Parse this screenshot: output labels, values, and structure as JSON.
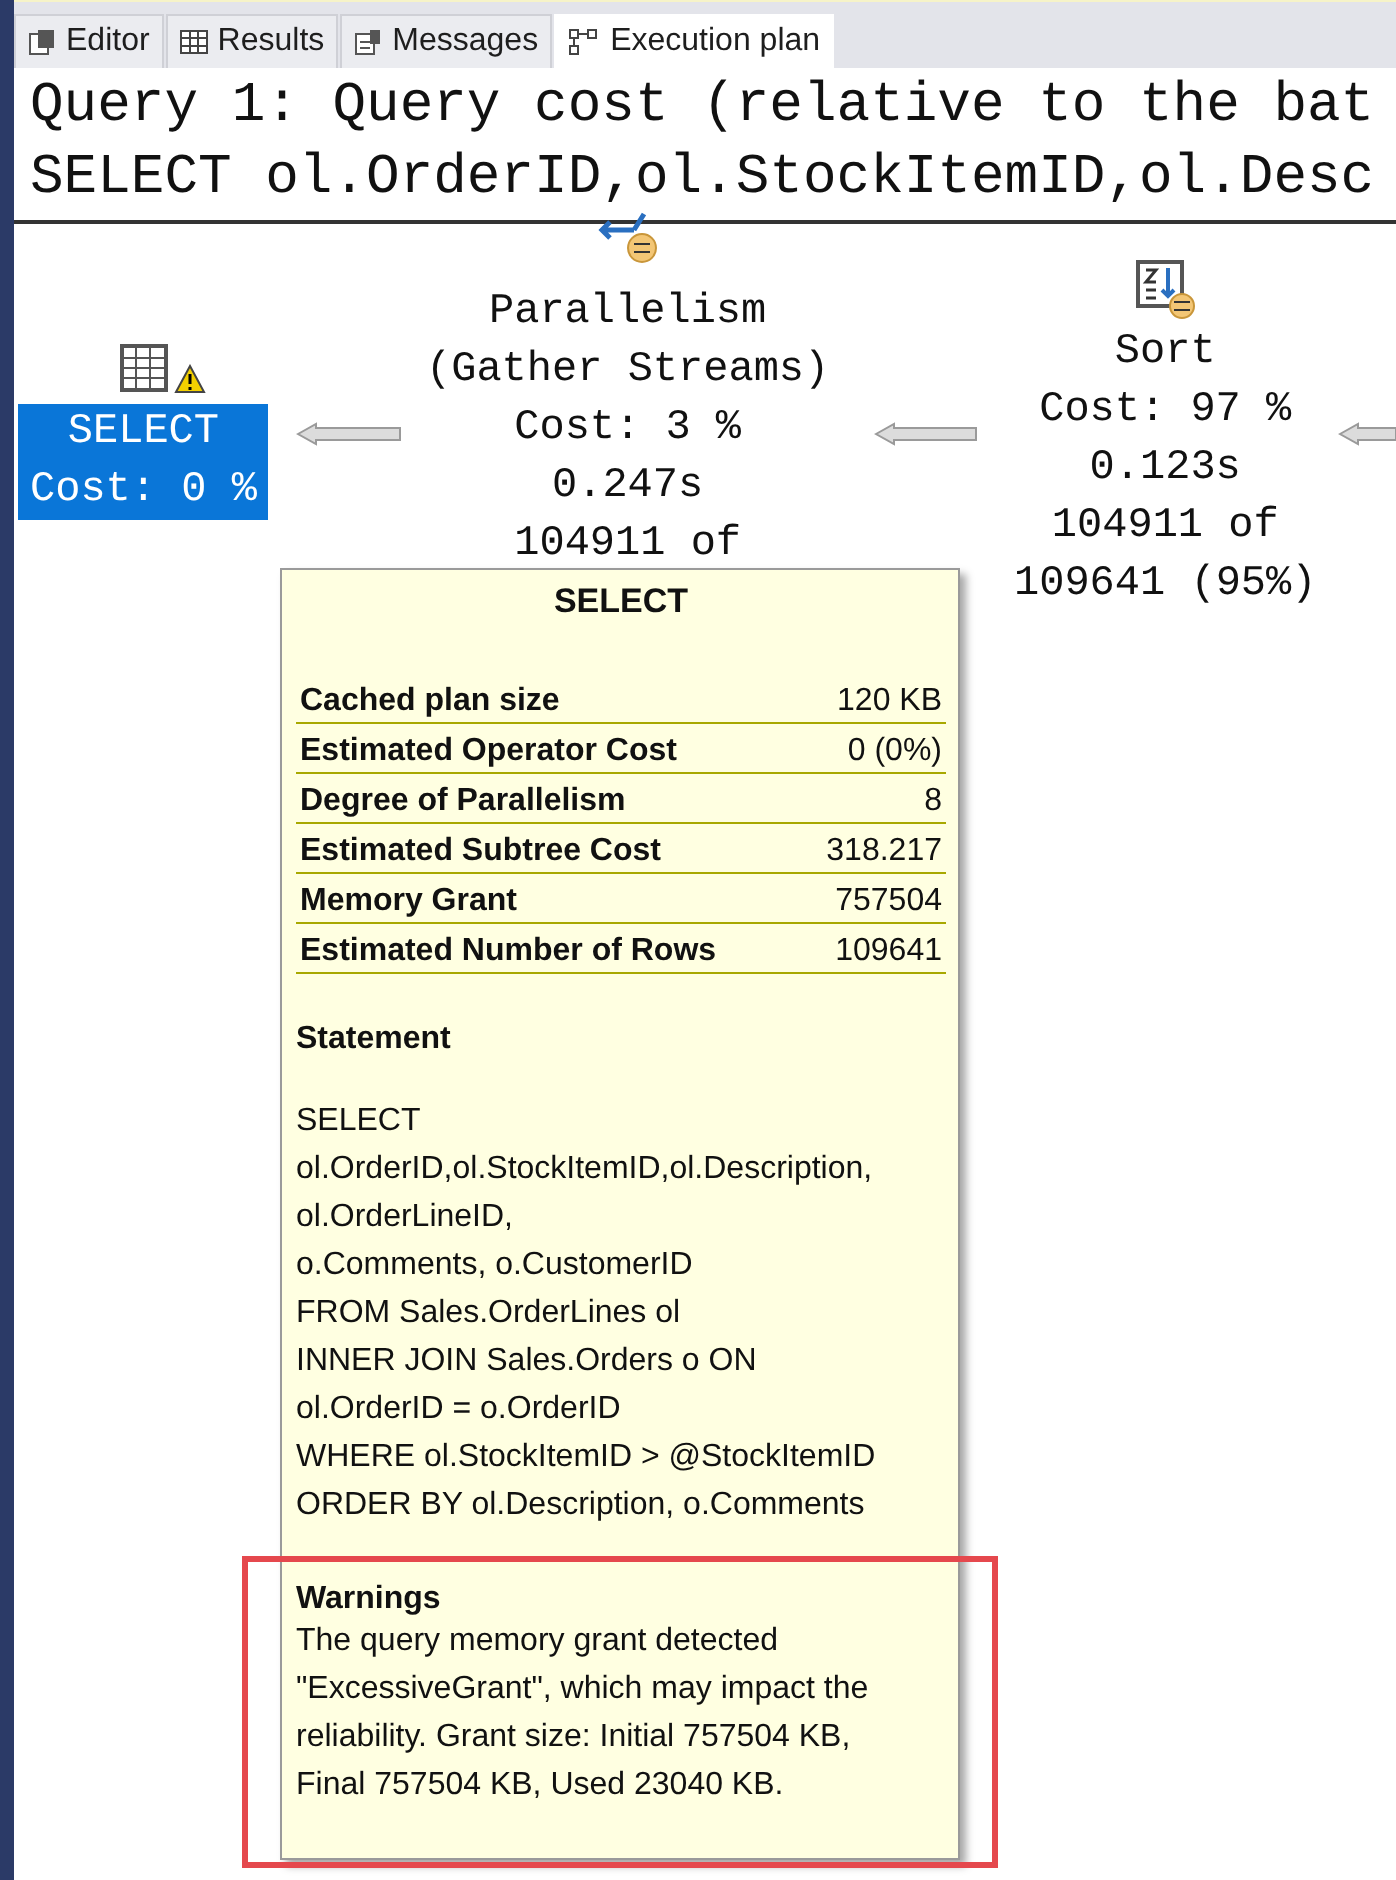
{
  "tabs": [
    {
      "label": "Editor",
      "kind": "editor",
      "selected": false
    },
    {
      "label": "Results",
      "kind": "grid",
      "selected": false
    },
    {
      "label": "Messages",
      "kind": "messages",
      "selected": false
    },
    {
      "label": "Execution plan",
      "kind": "plan",
      "selected": true
    }
  ],
  "query_header": [
    "Query 1: Query cost (relative to the bat",
    "SELECT ol.OrderID,ol.StockItemID,ol.Desc"
  ],
  "plan_nodes": [
    {
      "kind": "select",
      "lines": [
        "SELECT",
        "Cost: 0 %"
      ],
      "selected": true,
      "warning": true
    },
    {
      "kind": "parallelism",
      "lines": [
        "Parallelism",
        "(Gather Streams)",
        "Cost: 3 %",
        "0.247s",
        "104911 of"
      ],
      "selected": false
    },
    {
      "kind": "sort",
      "lines": [
        "Sort",
        "Cost: 97 %",
        "0.123s",
        "104911 of",
        "109641 (95%)"
      ],
      "selected": false
    }
  ],
  "tooltip": {
    "title": "SELECT",
    "properties": [
      {
        "name": "Cached plan size",
        "value": "120 KB"
      },
      {
        "name": "Estimated Operator Cost",
        "value": "0 (0%)"
      },
      {
        "name": "Degree of Parallelism",
        "value": "8"
      },
      {
        "name": "Estimated Subtree Cost",
        "value": "318.217"
      },
      {
        "name": "Memory Grant",
        "value": "757504"
      },
      {
        "name": "Estimated Number of Rows",
        "value": "109641"
      }
    ],
    "statement_heading": "Statement",
    "statement_lines": [
      "SELECT",
      "ol.OrderID,ol.StockItemID,ol.Description,",
      "ol.OrderLineID,",
      "o.Comments, o.CustomerID",
      "FROM Sales.OrderLines ol",
      "INNER JOIN Sales.Orders o ON",
      "ol.OrderID = o.OrderID",
      "WHERE ol.StockItemID > @StockItemID",
      "ORDER BY ol.Description, o.Comments"
    ],
    "warnings_heading": "Warnings",
    "warnings_lines": [
      "The query memory grant detected",
      "\"ExcessiveGrant\", which may impact the",
      "reliability. Grant size: Initial 757504 KB,",
      "Final 757504 KB, Used 23040 KB."
    ],
    "warnings_highlighted": true
  }
}
